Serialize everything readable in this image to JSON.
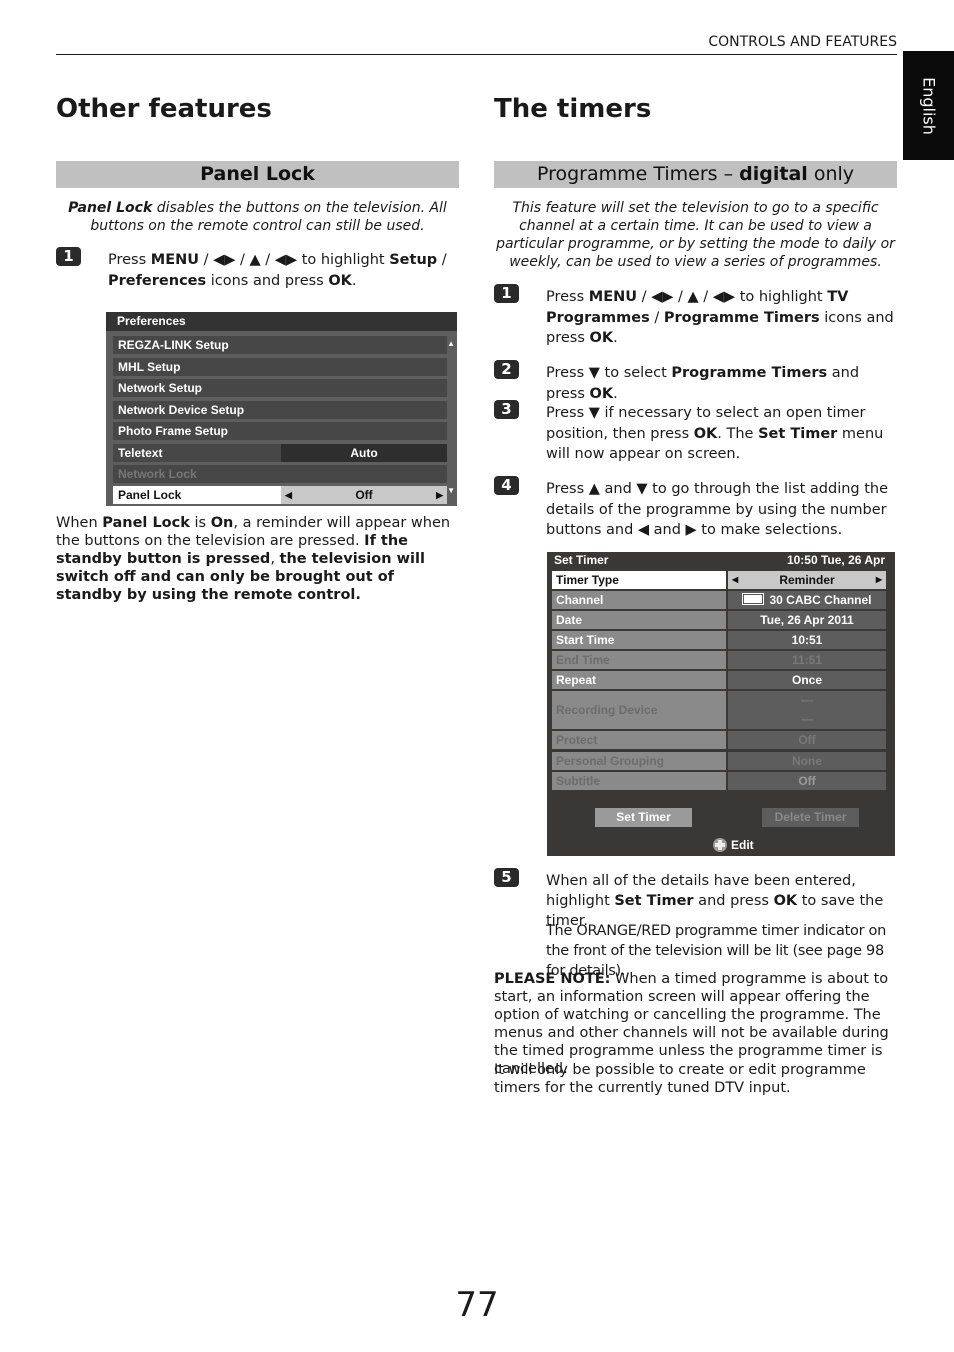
{
  "header": {
    "title": "CONTROLS AND FEATURES",
    "language_tab": "English"
  },
  "left": {
    "heading": "Other features",
    "section": "Panel Lock",
    "intro_bold": "Panel Lock",
    "intro_rest": " disables the buttons on the television. All buttons on the remote control can still be used.",
    "step1": {
      "number": "1",
      "parts": [
        "Press ",
        "MENU",
        " / ◀▶ / ▲ / ◀▶ to highlight ",
        "Setup",
        " / ",
        "Preferences",
        " icons and press ",
        "OK",
        "."
      ]
    },
    "prefs_menu": {
      "title": "Preferences",
      "items": [
        {
          "label": "REGZA-LINK Setup",
          "value": ""
        },
        {
          "label": "MHL Setup",
          "value": ""
        },
        {
          "label": "Network Setup",
          "value": ""
        },
        {
          "label": "Network Device Setup",
          "value": ""
        },
        {
          "label": "Photo Frame Setup",
          "value": ""
        },
        {
          "label": "Teletext",
          "value": "Auto"
        },
        {
          "label": "Network Lock",
          "value": "",
          "disabled": true
        },
        {
          "label": "Panel Lock",
          "value": "Off",
          "selected": true
        }
      ],
      "scroll_up": "▲",
      "scroll_down": "▼",
      "arrow_left": "◀",
      "arrow_right": "▶"
    },
    "note": {
      "parts": [
        "When ",
        "Panel Lock",
        " is ",
        "On",
        ", a reminder will appear when the buttons on the television are pressed. ",
        "If the standby button is pressed",
        ", ",
        "the television will switch off and can only be brought out of standby by using the remote control."
      ]
    }
  },
  "right": {
    "heading": "The timers",
    "section_pre": "Programme Timers – ",
    "section_bold": "digital",
    "section_post": " only",
    "intro": "This feature will set the television to go to a specific channel at a certain time. It can be used to view a particular programme, or by setting the mode to daily or weekly, can be used to view a series of programmes.",
    "steps": [
      {
        "number": "1",
        "parts": [
          "Press ",
          "MENU",
          " / ◀▶ / ▲ / ◀▶ to highlight ",
          "TV Programmes",
          " / ",
          "Programme Timers",
          " icons and press ",
          "OK",
          "."
        ]
      },
      {
        "number": "2",
        "parts": [
          "Press ▼ to select ",
          "Programme Timers",
          " and press ",
          "OK",
          "."
        ]
      },
      {
        "number": "3",
        "parts": [
          "Press ▼ if necessary to select an open timer position, then press ",
          "OK",
          ". The ",
          "Set Timer",
          " menu will now appear on screen."
        ]
      },
      {
        "number": "4",
        "parts": [
          "Press ▲ and ▼ to go through the list adding the details of the programme by using the number buttons and ◀ and ▶ to make selections."
        ]
      },
      {
        "number": "5",
        "parts": [
          "When all of the details have been entered, highlight ",
          "Set Timer",
          " and press ",
          "OK",
          " to save the timer."
        ]
      }
    ],
    "timer_menu": {
      "title": "Set Timer",
      "clock": "10:50 Tue, 26 Apr",
      "rows": [
        {
          "label": "Timer Type",
          "value": "Reminder",
          "selected": true
        },
        {
          "label": "Channel",
          "value": "30 CABC Channel"
        },
        {
          "label": "Date",
          "value": "Tue, 26 Apr 2011"
        },
        {
          "label": "Start Time",
          "value": "10:51"
        },
        {
          "label": "End Time",
          "value": "11:51",
          "disabled": true
        },
        {
          "label": "Repeat",
          "value": "Once"
        },
        {
          "label": "Recording Device",
          "value": "—",
          "value2": "—",
          "disabled": true
        },
        {
          "label": "Protect",
          "value": "Off",
          "disabled": true
        },
        {
          "label": "Personal Grouping",
          "value": "None",
          "disabled": true
        },
        {
          "label": "Subtitle",
          "value": "Off",
          "disabled": true
        }
      ],
      "set_button": "Set Timer",
      "delete_button": "Delete Timer",
      "edit_hint": "Edit"
    },
    "step5_note": "The ORANGE/RED programme timer indicator on the front of the television will be lit (see page 98 for details).",
    "please_note_label": "PLEASE NOTE:",
    "please_note_text": " When a timed programme is about to start, an information screen will appear offering the option of watching or cancelling the programme. The menus and other channels will not be available during the timed programme unless the programme timer is cancelled.",
    "final_note": "It will only be possible to create or edit programme timers for the currently tuned DTV input."
  },
  "page_number": "77"
}
